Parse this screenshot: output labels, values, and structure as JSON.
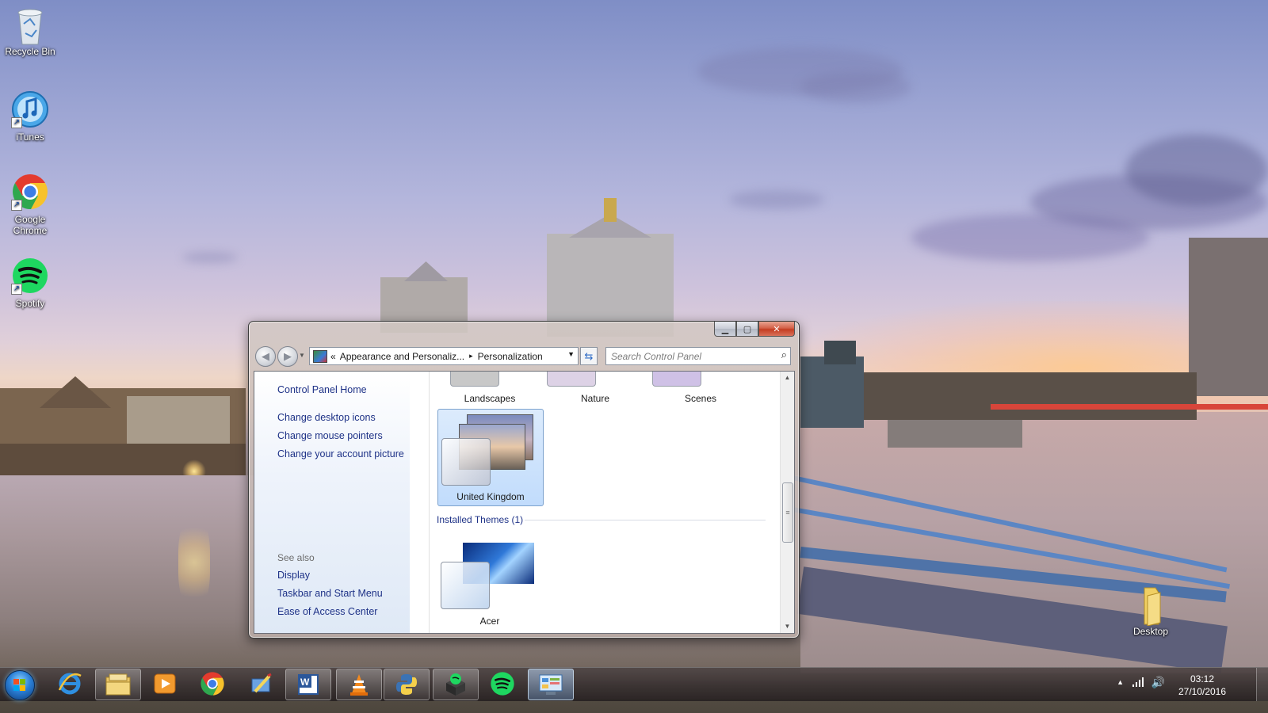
{
  "desktop": {
    "icons": [
      {
        "label": "Recycle Bin",
        "icon": "recycle-bin-icon"
      },
      {
        "label": "iTunes",
        "icon": "itunes-icon"
      },
      {
        "label": "Google Chrome",
        "icon": "chrome-icon"
      },
      {
        "label": "Spotify",
        "icon": "spotify-icon"
      },
      {
        "label": "Desktop",
        "icon": "folder-icon"
      }
    ]
  },
  "window": {
    "address": {
      "prefix": "«",
      "crumb1": "Appearance and Personaliz...",
      "separator": "▸",
      "crumb2": "Personalization"
    },
    "search_placeholder": "Search Control Panel",
    "left_pane": {
      "home_link": "Control Panel Home",
      "links": [
        "Change desktop icons",
        "Change mouse pointers",
        "Change your account picture"
      ],
      "see_also_label": "See also",
      "see_also": [
        "Display",
        "Taskbar and Start Menu",
        "Ease of Access Center"
      ]
    },
    "themes": {
      "top_row": [
        "Landscapes",
        "Nature",
        "Scenes"
      ],
      "selected": "United Kingdom",
      "installed_header": "Installed Themes (1)",
      "installed": [
        "Acer"
      ]
    }
  },
  "taskbar": {
    "apps": [
      {
        "name": "internet-explorer",
        "icon": "ie-icon"
      },
      {
        "name": "windows-explorer",
        "icon": "folder-icon"
      },
      {
        "name": "media-player",
        "icon": "media-player-icon"
      },
      {
        "name": "chrome",
        "icon": "chrome-icon"
      },
      {
        "name": "paint",
        "icon": "paint-icon"
      },
      {
        "name": "word",
        "icon": "word-icon"
      },
      {
        "name": "vlc",
        "icon": "vlc-icon"
      },
      {
        "name": "python",
        "icon": "python-icon"
      },
      {
        "name": "spotify-installer",
        "icon": "spotify-box-icon"
      },
      {
        "name": "spotify",
        "icon": "spotify-icon"
      },
      {
        "name": "control-panel",
        "icon": "control-panel-icon"
      }
    ],
    "clock": {
      "time": "03:12",
      "date": "27/10/2016"
    }
  },
  "colors": {
    "link": "#1e3287",
    "accent": "#2a7fd6",
    "close": "#c43d22"
  }
}
